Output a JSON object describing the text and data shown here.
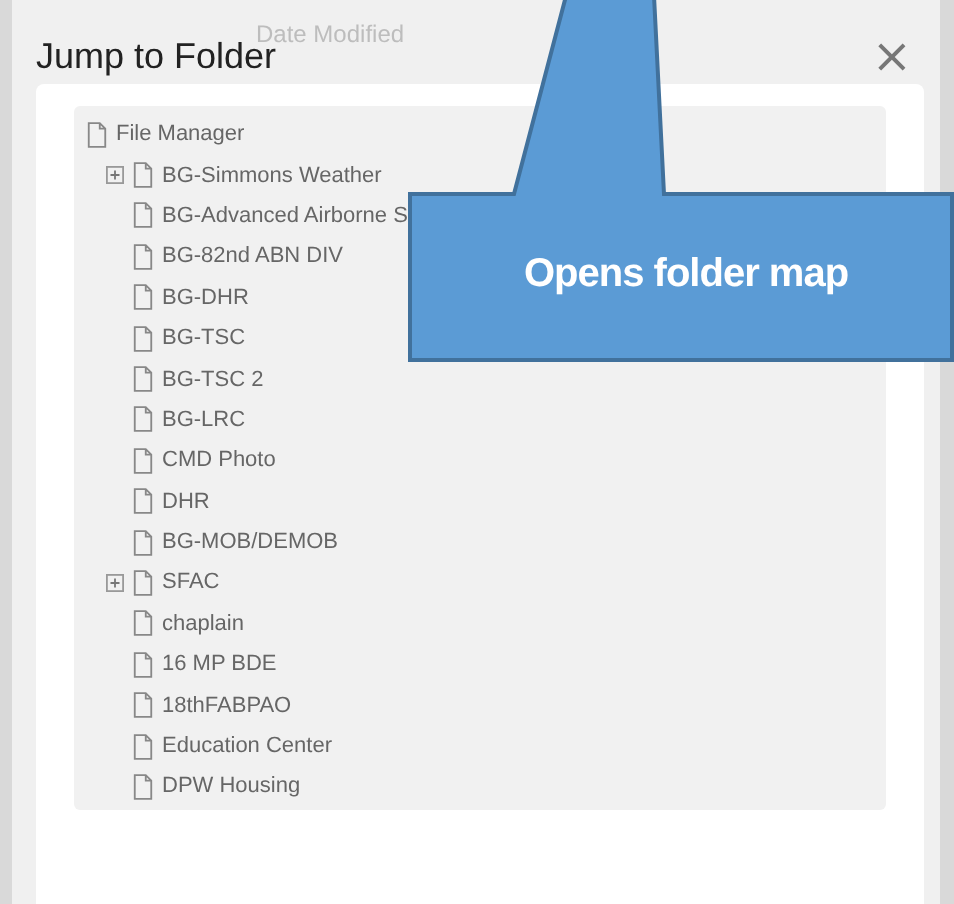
{
  "background": {
    "column_label": "Date Modified"
  },
  "dialog": {
    "title": "Jump to Folder",
    "close": "×"
  },
  "tree": {
    "label": "File Manager",
    "children": [
      {
        "label": "BG-Simmons Weather",
        "kind": "expandable"
      },
      {
        "label": "BG-Advanced Airborne S",
        "kind": "plain"
      },
      {
        "label": "BG-82nd ABN DIV",
        "kind": "plain"
      },
      {
        "label": "BG-DHR",
        "kind": "plain"
      },
      {
        "label": "BG-TSC",
        "kind": "plain"
      },
      {
        "label": "BG-TSC 2",
        "kind": "plain"
      },
      {
        "label": "BG-LRC",
        "kind": "plain"
      },
      {
        "label": "CMD Photo",
        "kind": "plain"
      },
      {
        "label": "DHR",
        "kind": "plain"
      },
      {
        "label": "BG-MOB/DEMOB",
        "kind": "plain"
      },
      {
        "label": "SFAC",
        "kind": "expandable"
      },
      {
        "label": "chaplain",
        "kind": "plain"
      },
      {
        "label": "16 MP BDE",
        "kind": "plain"
      },
      {
        "label": "18thFABPAO",
        "kind": "plain"
      },
      {
        "label": "Education Center",
        "kind": "plain"
      },
      {
        "label": "DPW Housing",
        "kind": "plain"
      }
    ]
  },
  "callout": {
    "text": "Opens folder map"
  }
}
